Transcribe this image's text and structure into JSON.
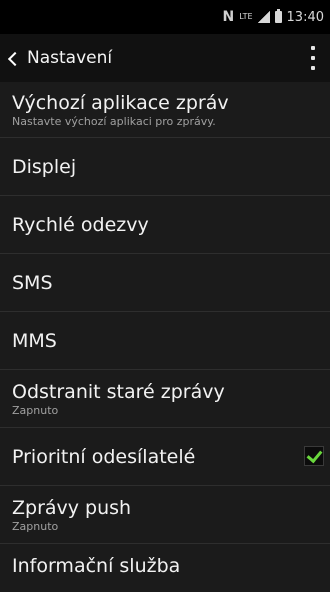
{
  "status_bar": {
    "nfc_icon": "N",
    "lte_label": "LTE",
    "time": "13:40"
  },
  "app_bar": {
    "title": "Nastavení",
    "back_icon": "chevron-left-icon",
    "more_icon": "more-vert-icon"
  },
  "settings": {
    "items": [
      {
        "title": "Výchozí aplikace zpráv",
        "subtitle": "Nastavte výchozí aplikaci pro zprávy."
      },
      {
        "title": "Displej"
      },
      {
        "title": "Rychlé odezvy"
      },
      {
        "title": "SMS"
      },
      {
        "title": "MMS"
      },
      {
        "title": "Odstranit staré zprávy",
        "subtitle": "Zapnuto"
      },
      {
        "title": "Prioritní odesílatelé",
        "checked": true
      },
      {
        "title": "Zprávy push",
        "subtitle": "Zapnuto"
      },
      {
        "title": "Informační služba"
      }
    ]
  },
  "colors": {
    "background": "#1b1b1b",
    "checkbox_check": "#6ad83d",
    "subtitle": "#a0a0a0"
  }
}
